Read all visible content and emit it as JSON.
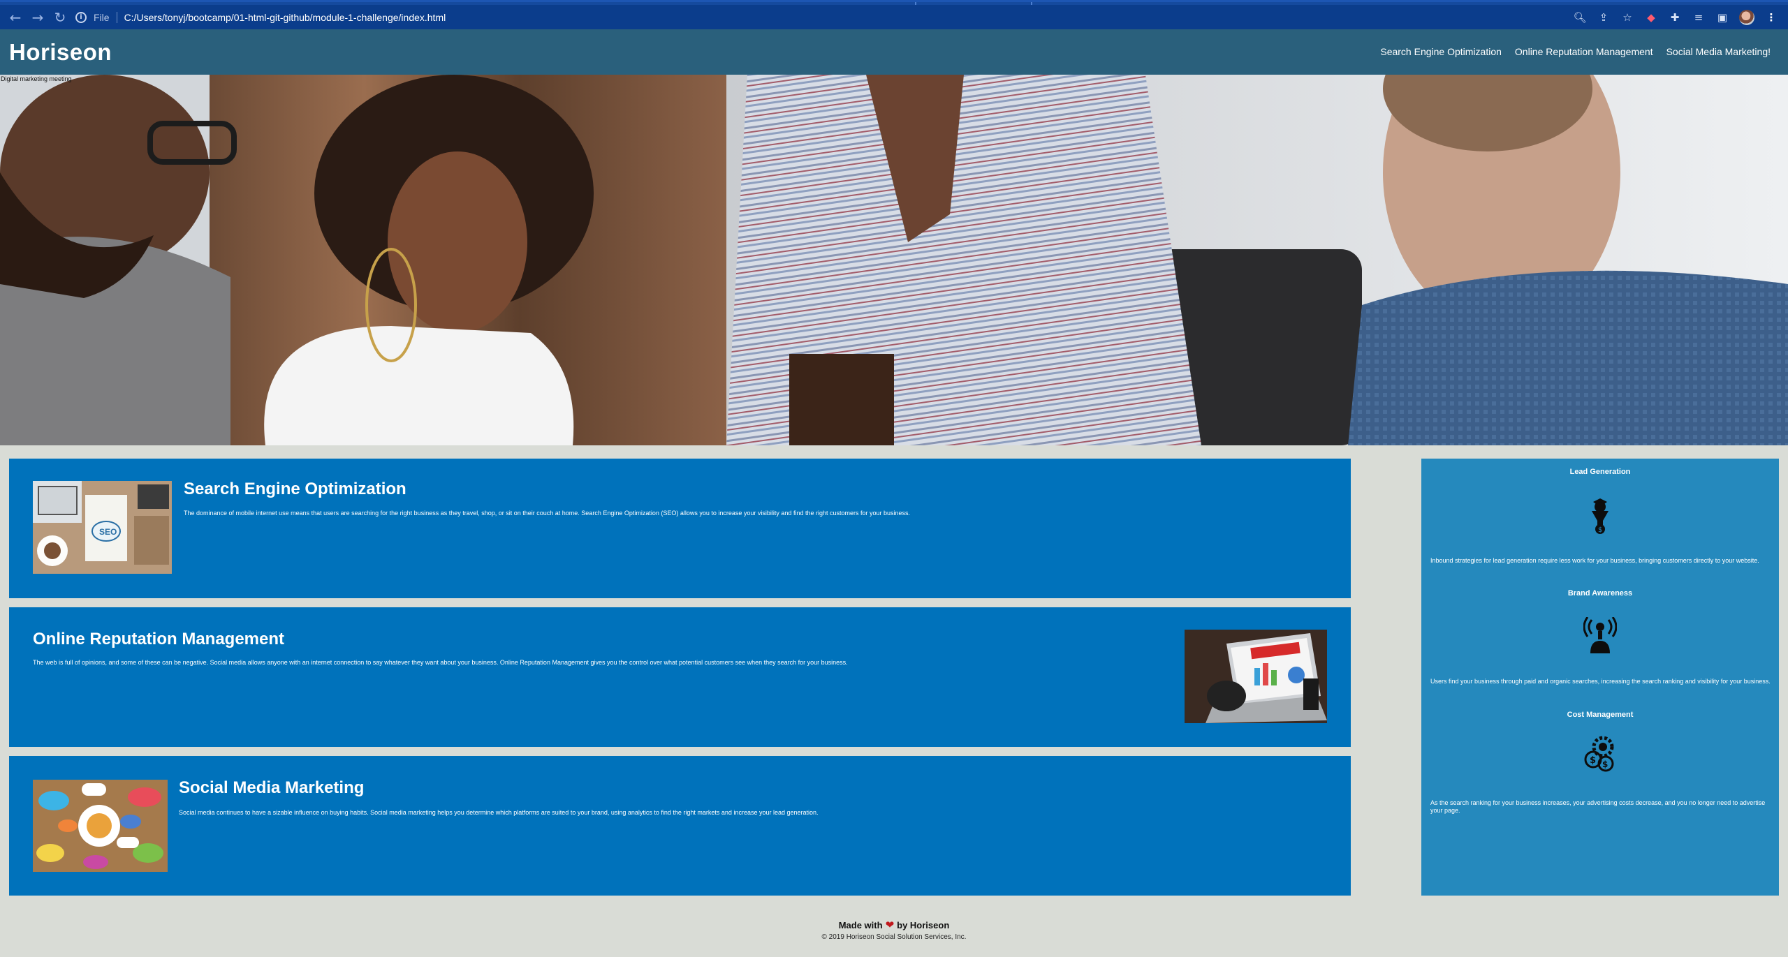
{
  "browser": {
    "url_scheme": "File",
    "url": "C:/Users/tonyj/bootcamp/01-html-git-github/module-1-challenge/index.html",
    "nav_icons": [
      "back-arrow-icon",
      "forward-arrow-icon",
      "reload-icon"
    ],
    "action_icons": [
      "zoom-icon",
      "share-icon",
      "star-icon",
      "extension-icon",
      "puzzle-icon",
      "reading-list-icon",
      "side-panel-icon",
      "profile-avatar",
      "more-menu-icon"
    ]
  },
  "header": {
    "logo": "Horiseon",
    "nav": [
      "Search Engine Optimization",
      "Online Reputation Management",
      "Social Media Marketing!"
    ]
  },
  "hero": {
    "alt_text": "Digital marketing meeting"
  },
  "content": [
    {
      "title": "Search Engine Optimization",
      "text": "The dominance of mobile internet use means that users are searching for the right business as they travel, shop, or sit on their couch at home. Search Engine Optimization (SEO) allows you to increase your visibility and find the right customers for your business."
    },
    {
      "title": "Online Reputation Management",
      "text": "The web is full of opinions, and some of these can be negative. Social media allows anyone with an internet connection to say whatever they want about your business. Online Reputation Management gives you the control over what potential customers see when they search for your business."
    },
    {
      "title": "Social Media Marketing",
      "text": "Social media continues to have a sizable influence on buying habits. Social media marketing helps you determine which platforms are suited to your brand, using analytics to find the right markets and increase your lead generation."
    }
  ],
  "benefits": [
    {
      "title": "Lead Generation",
      "icon": "lead-generation-icon",
      "text": "Inbound strategies for lead generation require less work for your business, bringing customers directly to your website."
    },
    {
      "title": "Brand Awareness",
      "icon": "brand-awareness-icon",
      "text": "Users find your business through paid and organic searches, increasing the search ranking and visibility for your business."
    },
    {
      "title": "Cost Management",
      "icon": "cost-management-icon",
      "text": "As the search ranking for your business increases, your advertising costs decrease, and you no longer need to advertise your page."
    }
  ],
  "footer": {
    "made_prefix": "Made with",
    "made_suffix": "by Horiseon",
    "copyright": "© 2019 Horiseon Social Solution Services, Inc."
  },
  "colors": {
    "chrome": "#0b3d8c",
    "header": "#2a607c",
    "card": "#0072bb",
    "benefits": "#2589bd",
    "page": "#d9dcd6",
    "heart": "#c0181c"
  }
}
